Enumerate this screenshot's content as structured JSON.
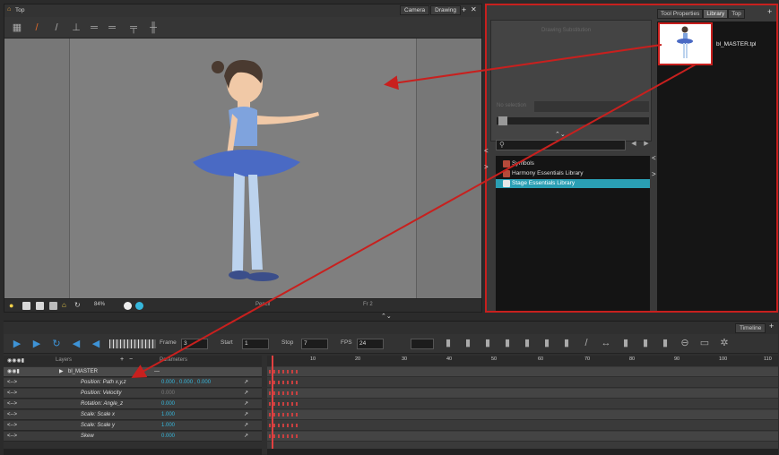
{
  "top_view": {
    "title": "Top",
    "tabs": [
      "Camera",
      "Drawing"
    ],
    "status_zoom": "84%",
    "status_mode": "Pencil",
    "status_frame": "Fr 2"
  },
  "library": {
    "tabs": [
      "Tool Properties",
      "Library",
      "Top"
    ],
    "drawing_substitution": "Drawing Substitution",
    "no_selection": "No selection",
    "template_name": "bl_MASTER.tpl",
    "tree": [
      "Symbols",
      "Harmony Essentials Library",
      "Stage Essentials Library"
    ]
  },
  "timeline": {
    "tab": "Timeline",
    "frame_label": "Frame",
    "frame_value": "3",
    "start_label": "Start",
    "start_value": "1",
    "stop_label": "Stop",
    "stop_value": "7",
    "fps_label": "FPS",
    "fps_value": "24",
    "layers_label": "Layers",
    "params_label": "Parameters",
    "master_layer": "bl_MASTER",
    "rows": [
      {
        "name": "Position: Path x,y,z",
        "value": "0.000 , 0.000 , 0.000"
      },
      {
        "name": "Position: Velocity",
        "value": "0.000"
      },
      {
        "name": "Rotation: Angle_z",
        "value": "0.000"
      },
      {
        "name": "Scale: Scale x",
        "value": "1.000"
      },
      {
        "name": "Scale: Scale y",
        "value": "1.000"
      },
      {
        "name": "Skew",
        "value": "0.000"
      }
    ],
    "ruler": [
      "10",
      "20",
      "30",
      "40",
      "50",
      "60",
      "70",
      "80",
      "90",
      "100",
      "110"
    ],
    "arrow_glyph": "<-->",
    "curve_glyph": "↗"
  },
  "colors": {
    "annotation": "#c8201e",
    "selection": "#2a9fb4",
    "param_value": "#36b7dc"
  }
}
